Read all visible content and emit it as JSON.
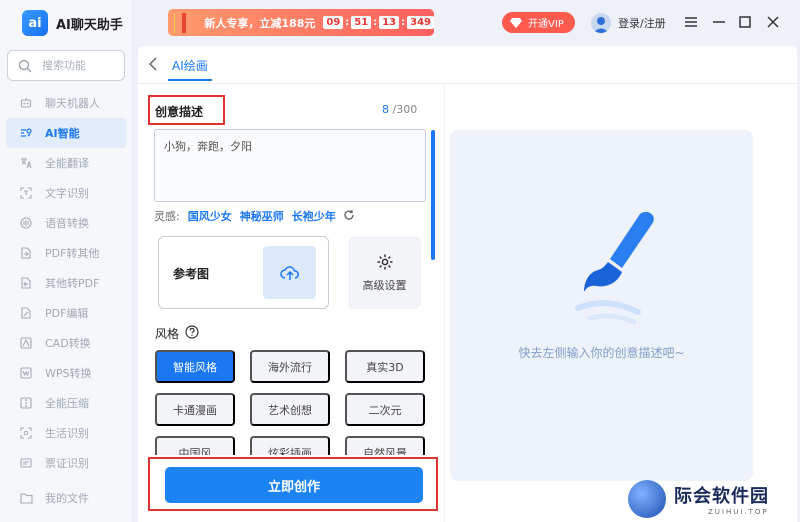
{
  "app": {
    "logo_text": "ai",
    "name": "AI聊天助手"
  },
  "search": {
    "placeholder": "搜索功能"
  },
  "sidebar": {
    "items": [
      {
        "label": "聊天机器人",
        "icon": "robot-icon"
      },
      {
        "label": "AI智能",
        "icon": "ai-icon",
        "active": true
      },
      {
        "label": "全能翻译",
        "icon": "translate-icon"
      },
      {
        "label": "文字识别",
        "icon": "ocr-icon"
      },
      {
        "label": "语音转换",
        "icon": "voice-icon"
      },
      {
        "label": "PDF转其他",
        "icon": "pdf-export-icon"
      },
      {
        "label": "其他转PDF",
        "icon": "pdf-import-icon"
      },
      {
        "label": "PDF编辑",
        "icon": "pdf-edit-icon"
      },
      {
        "label": "CAD转换",
        "icon": "cad-icon"
      },
      {
        "label": "WPS转换",
        "icon": "wps-icon"
      },
      {
        "label": "全能压缩",
        "icon": "compress-icon"
      },
      {
        "label": "生活识别",
        "icon": "scan-icon"
      },
      {
        "label": "票证识别",
        "icon": "ticket-icon"
      }
    ],
    "my_files": "我的文件"
  },
  "topbar": {
    "promo_text": "新人专享，立减188元",
    "timer": [
      "09",
      "51",
      "13",
      "349"
    ],
    "vip_label": "开通VIP",
    "login_label": "登录/注册"
  },
  "tabs": {
    "active_label": "AI绘画"
  },
  "creative": {
    "title": "创意描述",
    "count": "8",
    "max": "/300",
    "prompt_value": "小狗，奔跑，夕阳",
    "inspire_label": "灵感:",
    "inspire_chips": [
      "国风少女",
      "神秘巫师",
      "长袍少年"
    ]
  },
  "reference": {
    "label": "参考图"
  },
  "advanced": {
    "label": "高级设置"
  },
  "style": {
    "title": "风格",
    "options": [
      "智能风格",
      "海外流行",
      "真实3D",
      "卡通漫画",
      "艺术创想",
      "二次元",
      "中国风",
      "炫彩插画",
      "自然风景"
    ],
    "selected": "智能风格"
  },
  "create_button": "立即创作",
  "preview": {
    "hint": "快去左侧输入你的创意描述吧~"
  },
  "watermark": {
    "title": "际会软件园",
    "subtitle": "ZUIHUI.TOP"
  },
  "colors": {
    "accent": "#1b78f2",
    "highlight": "#e03131",
    "vip": "#ff5a4e"
  }
}
